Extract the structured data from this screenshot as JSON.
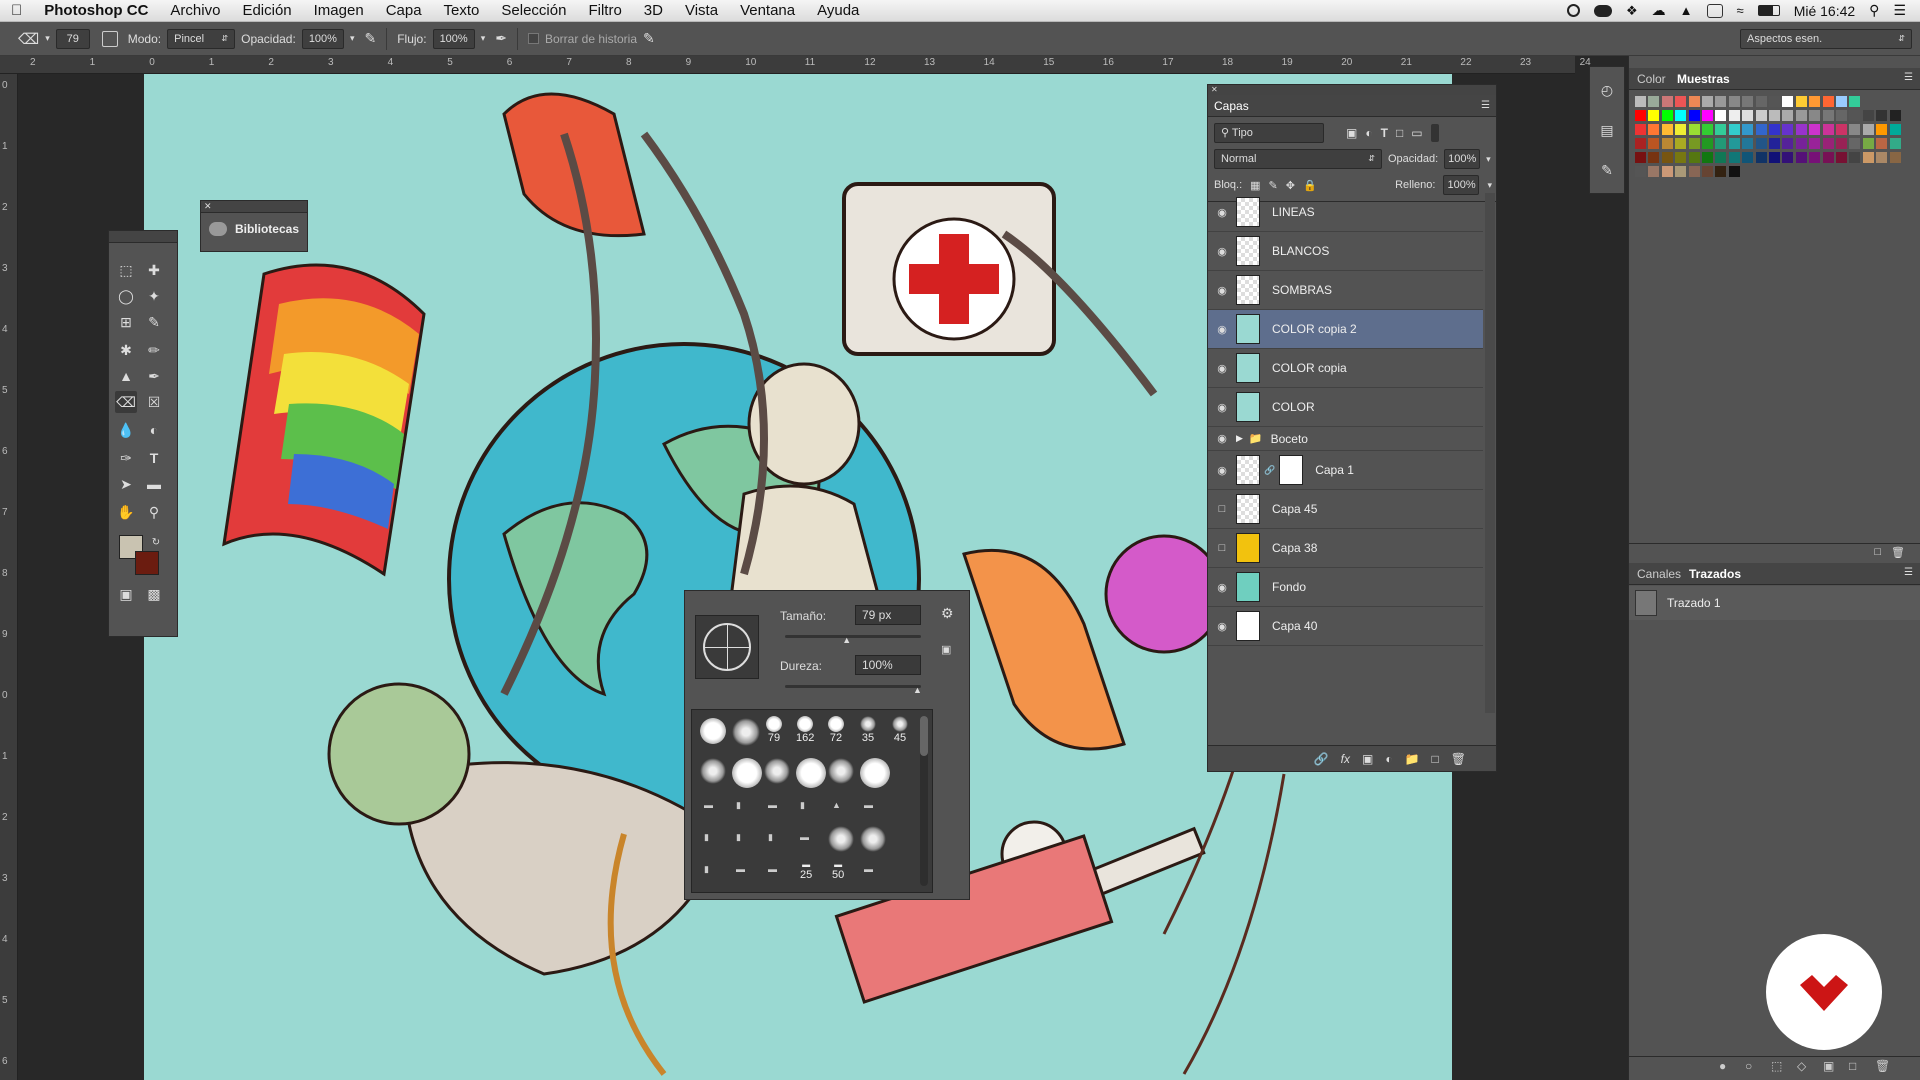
{
  "menubar": {
    "app": "Photoshop CC",
    "items": [
      "Archivo",
      "Edición",
      "Imagen",
      "Capa",
      "Texto",
      "Selección",
      "Filtro",
      "3D",
      "Vista",
      "Ventana",
      "Ayuda"
    ],
    "clock": "Mié 16:42"
  },
  "options": {
    "brush_size": "79",
    "mode_label": "Modo:",
    "mode_value": "Pincel",
    "opacity_label": "Opacidad:",
    "opacity_value": "100%",
    "flow_label": "Flujo:",
    "flow_value": "100%",
    "erase_history": "Borrar de historia",
    "workspace": "Aspectos esen."
  },
  "ruler": {
    "top_ticks": [
      "2",
      "1",
      "0",
      "1",
      "2",
      "3",
      "4",
      "5",
      "6",
      "7",
      "8",
      "9",
      "10",
      "11",
      "12",
      "13",
      "14",
      "15",
      "16",
      "17",
      "18",
      "19",
      "20",
      "21",
      "22",
      "23",
      "24"
    ],
    "left_ticks": [
      "0",
      "1",
      "2",
      "3",
      "4",
      "5",
      "6",
      "7",
      "8",
      "9",
      "0",
      "1",
      "2",
      "3",
      "4",
      "5",
      "6"
    ]
  },
  "libraries": {
    "label": "Bibliotecas"
  },
  "brush_picker": {
    "size_label": "Tamaño:",
    "size_value": "79 px",
    "hardness_label": "Dureza:",
    "hardness_value": "100%",
    "size_fraction": 0.45,
    "hardness_fraction": 1.0,
    "presets_row1": [
      "",
      "",
      "79",
      "162",
      "72",
      "35",
      "45"
    ],
    "presets_numbers_row4": [
      "25",
      "50"
    ]
  },
  "layers": {
    "title": "Capas",
    "filter": "Tipo",
    "blend": "Normal",
    "opacity_label": "Opacidad:",
    "opacity_value": "100%",
    "lock_label": "Bloq.:",
    "fill_label": "Relleno:",
    "fill_value": "100%",
    "items": [
      {
        "name": "LINEAS",
        "visible": true
      },
      {
        "name": "BLANCOS",
        "visible": true
      },
      {
        "name": "SOMBRAS",
        "visible": true
      },
      {
        "name": "COLOR copia 2",
        "visible": true,
        "active": true
      },
      {
        "name": "COLOR copia",
        "visible": true
      },
      {
        "name": "COLOR",
        "visible": true
      },
      {
        "name": "Boceto",
        "visible": true,
        "group": true
      },
      {
        "name": "Capa 1",
        "visible": true
      },
      {
        "name": "Capa 45",
        "visible": false
      },
      {
        "name": "Capa 38",
        "visible": false
      },
      {
        "name": "Fondo",
        "visible": true
      },
      {
        "name": "Capa 40",
        "visible": true
      }
    ]
  },
  "right_panel": {
    "tab_color": "Color",
    "tab_swatches": "Muestras",
    "tab_channels": "Canales",
    "tab_paths": "Trazados",
    "path_item": "Trazado 1"
  },
  "colors": {
    "fg": "#c9c3b1",
    "bg": "#6b1c10",
    "active_layer": "#5e6e8d",
    "accent_logo": "#cc1515"
  }
}
